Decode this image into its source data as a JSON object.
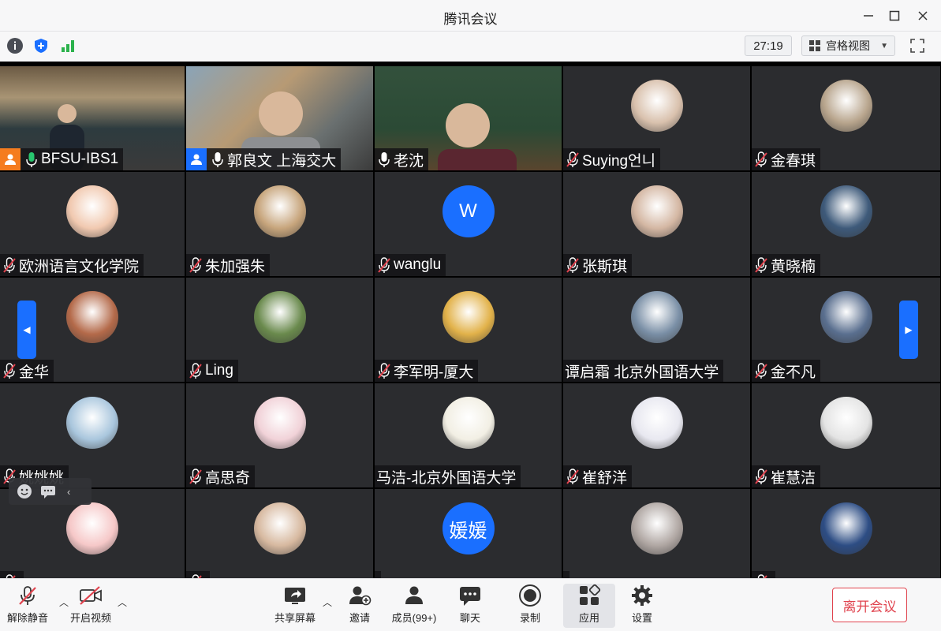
{
  "window": {
    "title": "腾讯会议"
  },
  "toolbar": {
    "icons": [
      "info-icon",
      "shield-icon",
      "signal-icon"
    ],
    "timer": "27:19",
    "view_label": "宫格视图"
  },
  "colors": {
    "accent": "#1a6fff",
    "leave": "#e0434e",
    "host": "#f57c1f",
    "speaking_border": "#28c76f"
  },
  "participants": [
    {
      "name": "BFSU-IBS1",
      "role": "host",
      "mic": "on",
      "type": "video"
    },
    {
      "name": "郭良文  上海交大",
      "role": "cohost",
      "mic": "on",
      "type": "video"
    },
    {
      "name": "老沈",
      "mic": "on",
      "type": "video"
    },
    {
      "name": "Suying언니",
      "mic": "muted",
      "type": "avatar"
    },
    {
      "name": "金春琪",
      "mic": "muted",
      "type": "avatar"
    },
    {
      "name": "欧洲语言文化学院",
      "mic": "muted",
      "type": "avatar"
    },
    {
      "name": "朱加强朱",
      "mic": "muted",
      "type": "avatar"
    },
    {
      "name": "wanglu",
      "mic": "muted",
      "type": "letter",
      "letter": "W"
    },
    {
      "name": "张斯琪",
      "mic": "muted",
      "type": "avatar"
    },
    {
      "name": "黄晓楠",
      "mic": "muted",
      "type": "avatar"
    },
    {
      "name": "金华",
      "mic": "muted",
      "type": "avatar"
    },
    {
      "name": "Ling",
      "mic": "muted",
      "type": "avatar"
    },
    {
      "name": "李军明-厦大",
      "mic": "muted",
      "type": "avatar"
    },
    {
      "name": "谭启霜 北京外国语大学",
      "mic": "none",
      "type": "avatar"
    },
    {
      "name": "金不凡",
      "mic": "muted",
      "type": "avatar"
    },
    {
      "name": "姚姚姚",
      "mic": "muted",
      "type": "avatar"
    },
    {
      "name": "高思奇",
      "mic": "muted",
      "type": "avatar"
    },
    {
      "name": "马洁-北京外国语大学",
      "mic": "none",
      "type": "avatar"
    },
    {
      "name": "崔舒洋",
      "mic": "muted",
      "type": "avatar"
    },
    {
      "name": "崔慧洁",
      "mic": "muted",
      "type": "avatar"
    },
    {
      "name": "",
      "mic": "muted",
      "type": "avatar"
    },
    {
      "name": "",
      "mic": "muted",
      "type": "avatar"
    },
    {
      "name": "",
      "mic": "none",
      "type": "letter",
      "letter": "媛媛"
    },
    {
      "name": "",
      "mic": "none",
      "type": "avatar"
    },
    {
      "name": "",
      "mic": "muted",
      "type": "avatar"
    }
  ],
  "bottom": {
    "unmute": "解除静音",
    "start_video": "开启视频",
    "share": "共享屏幕",
    "invite": "邀请",
    "members": "成员(99+)",
    "chat": "聊天",
    "record": "录制",
    "apps": "应用",
    "settings": "设置",
    "leave": "离开会议"
  }
}
